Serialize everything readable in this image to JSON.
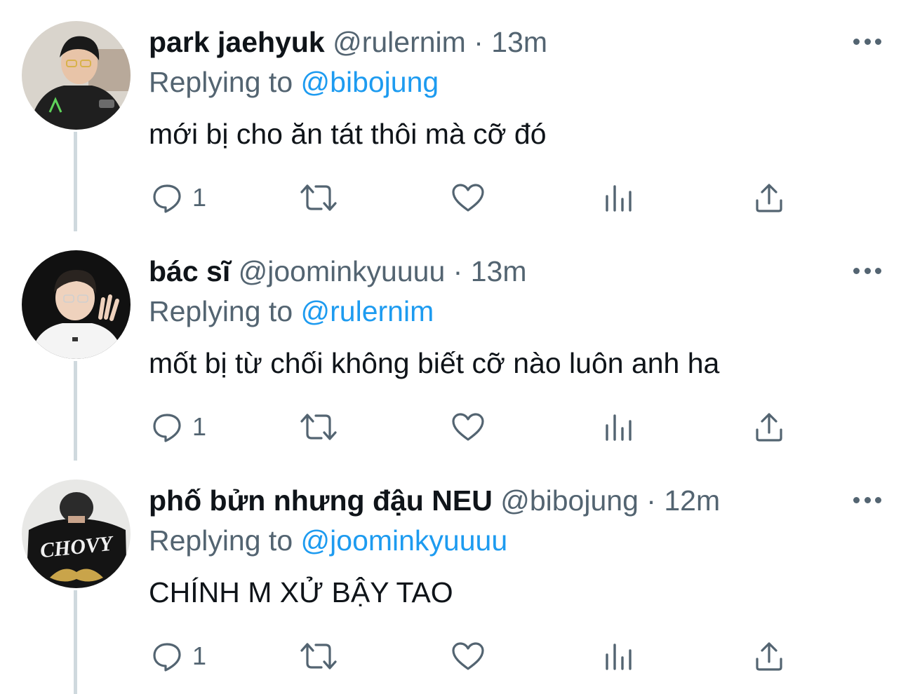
{
  "tweets": [
    {
      "name": "park jaehyuk",
      "handle": "@rulernim",
      "dot": "·",
      "time": "13m",
      "replying_prefix": "Replying to",
      "replying_to": "@bibojung",
      "text": "mới bị cho ăn tát thôi mà cỡ đó",
      "reply_count": "1",
      "avatar": {
        "bg": "#d9d4cc",
        "shirt": "#1f1f1f",
        "skin": "#e8c4a8",
        "hair": "#1a1a1a"
      }
    },
    {
      "name": "bác sĩ",
      "handle": "@joominkyuuuu",
      "dot": "·",
      "time": "13m",
      "replying_prefix": "Replying to",
      "replying_to": "@rulernim",
      "text": "mốt bị từ chối không biết cỡ nào luôn anh ha",
      "reply_count": "1",
      "avatar": {
        "bg": "#111111",
        "shirt": "#f4f4f4",
        "skin": "#efd2bd",
        "hair": "#2a2420"
      }
    },
    {
      "name": "phố bửn nhưng đậu NEU",
      "handle": "@bibojung",
      "dot": "·",
      "time": "12m",
      "replying_prefix": "Replying to",
      "replying_to": "@joominkyuuuu",
      "text": "CHÍNH M XỬ BẬY TAO",
      "reply_count": "1",
      "avatar": {
        "bg": "#e8e8e6",
        "shirt": "#141414",
        "skin": "#c9a48c",
        "hair": "#2b2b2b",
        "shirt_text": "CHOVY"
      }
    }
  ],
  "icons": {
    "reply": "speech-bubble-icon",
    "retweet": "retweet-icon",
    "like": "heart-icon",
    "analytics": "bar-chart-icon",
    "share": "share-icon",
    "more": "more-dots-icon"
  },
  "colors": {
    "link": "#1d9bf0",
    "muted": "#536471",
    "text": "#0f1419",
    "thread": "#cfd9de"
  }
}
